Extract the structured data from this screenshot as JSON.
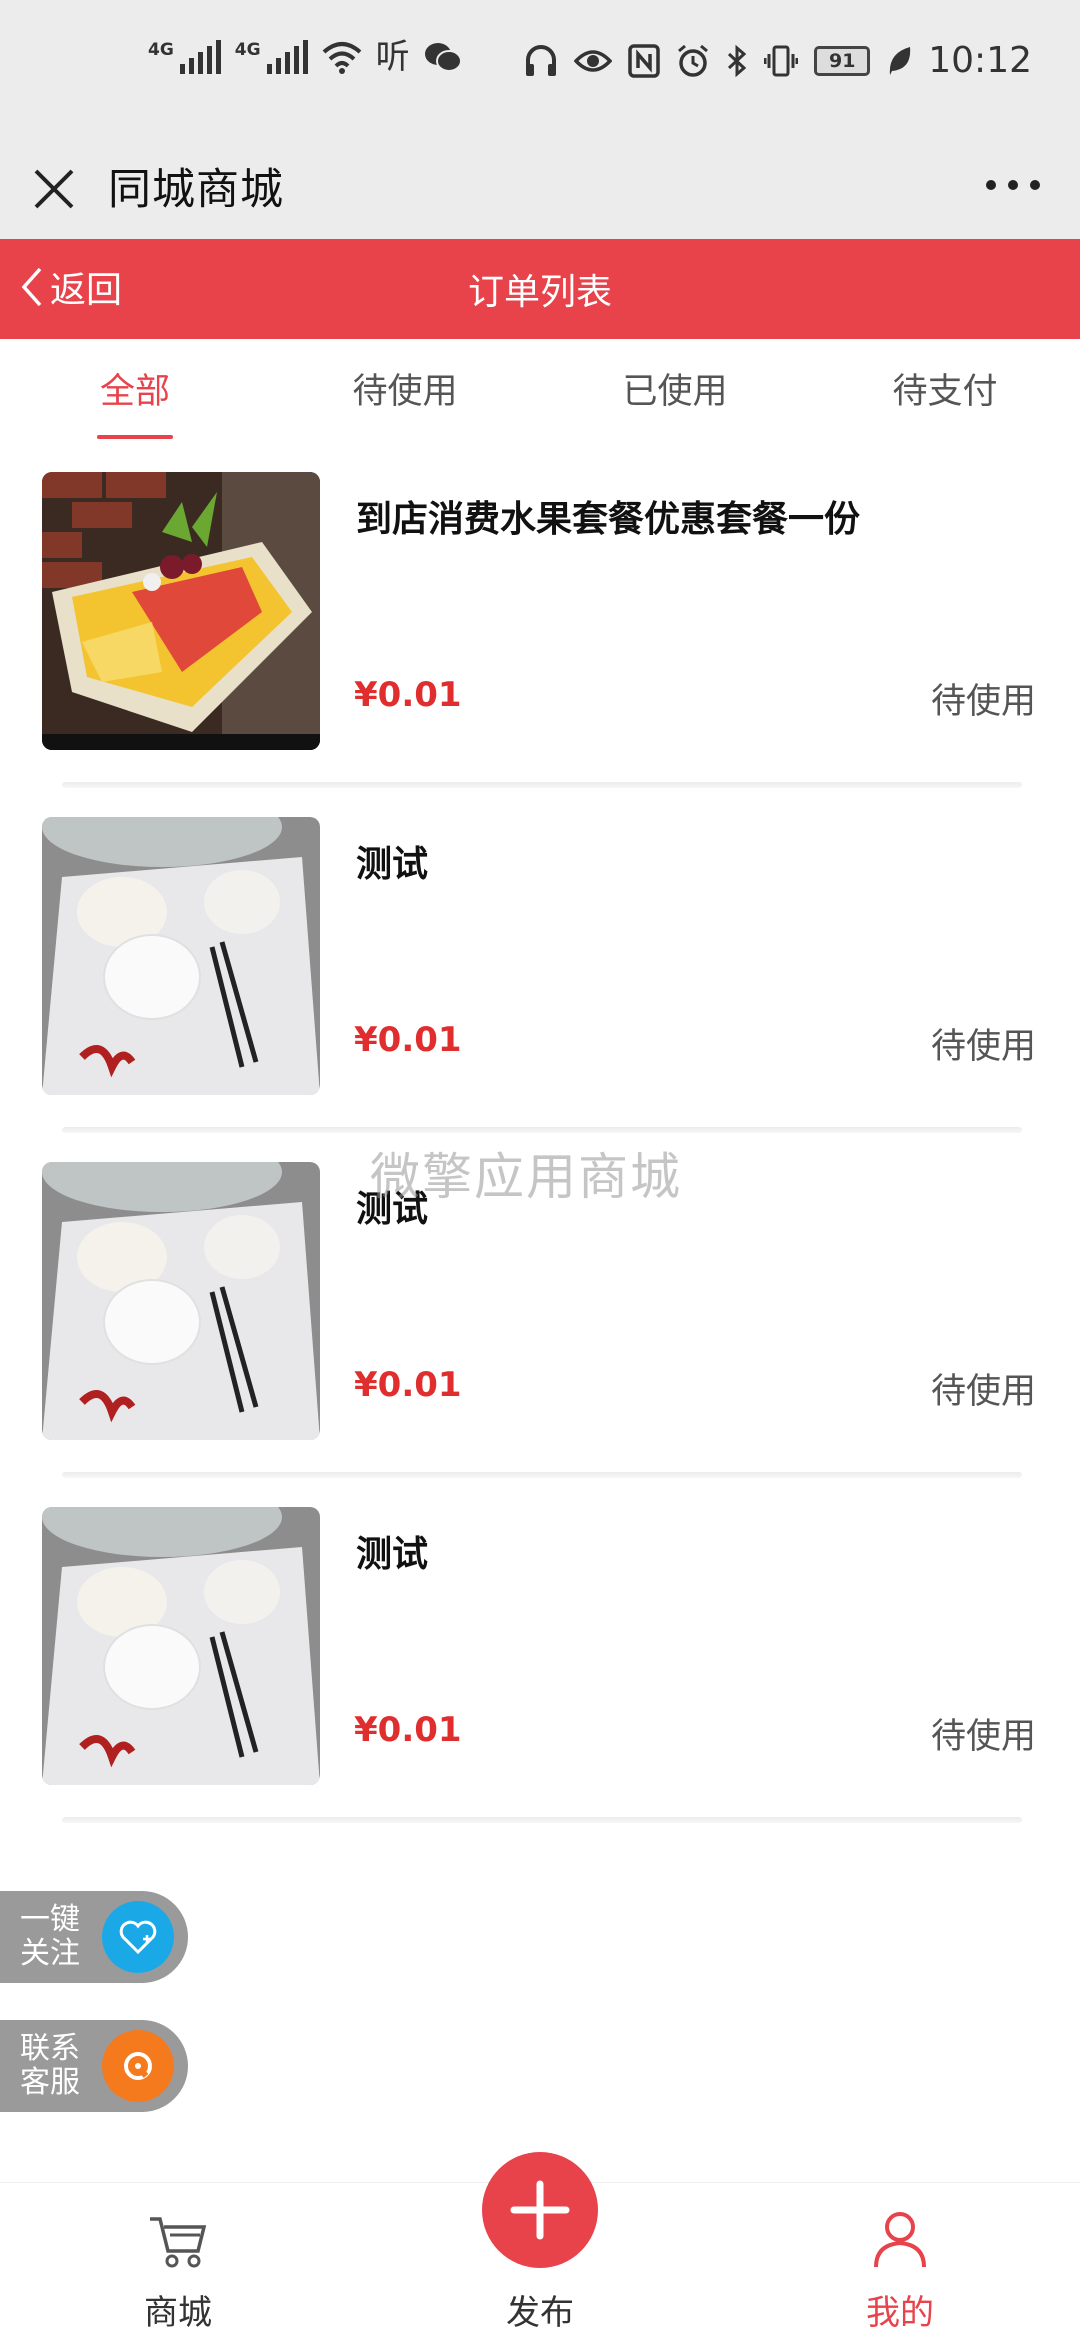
{
  "status_bar": {
    "signal1_label": "4G",
    "signal2_label": "4G",
    "wifi_label": "wifi",
    "hd_label": "听",
    "battery": "91",
    "time": "10:12"
  },
  "app_header": {
    "title": "同城商城"
  },
  "nav": {
    "back_label": "返回",
    "title": "订单列表"
  },
  "tabs": [
    {
      "label": "全部",
      "active": true
    },
    {
      "label": "待使用",
      "active": false
    },
    {
      "label": "已使用",
      "active": false
    },
    {
      "label": "待支付",
      "active": false
    }
  ],
  "orders": [
    {
      "title": "到店消费水果套餐优惠套餐一份",
      "price": "¥0.01",
      "status": "待使用",
      "image": "fruit-platter"
    },
    {
      "title": "测试",
      "price": "¥0.01",
      "status": "待使用",
      "image": "tableware"
    },
    {
      "title": "测试",
      "price": "¥0.01",
      "status": "待使用",
      "image": "tableware"
    },
    {
      "title": "测试",
      "price": "¥0.01",
      "status": "待使用",
      "image": "tableware"
    }
  ],
  "watermark": "微擎应用商城",
  "float_buttons": {
    "follow": "一键关注",
    "follow_lines": [
      "一键",
      "关注"
    ],
    "service_lines": [
      "联系",
      "客服"
    ]
  },
  "tabbar": {
    "shop": "商城",
    "publish": "发布",
    "mine": "我的"
  },
  "colors": {
    "accent": "#e8424b",
    "price": "#e02e2e",
    "follow": "#1aa9e6",
    "service": "#f57a1e"
  }
}
